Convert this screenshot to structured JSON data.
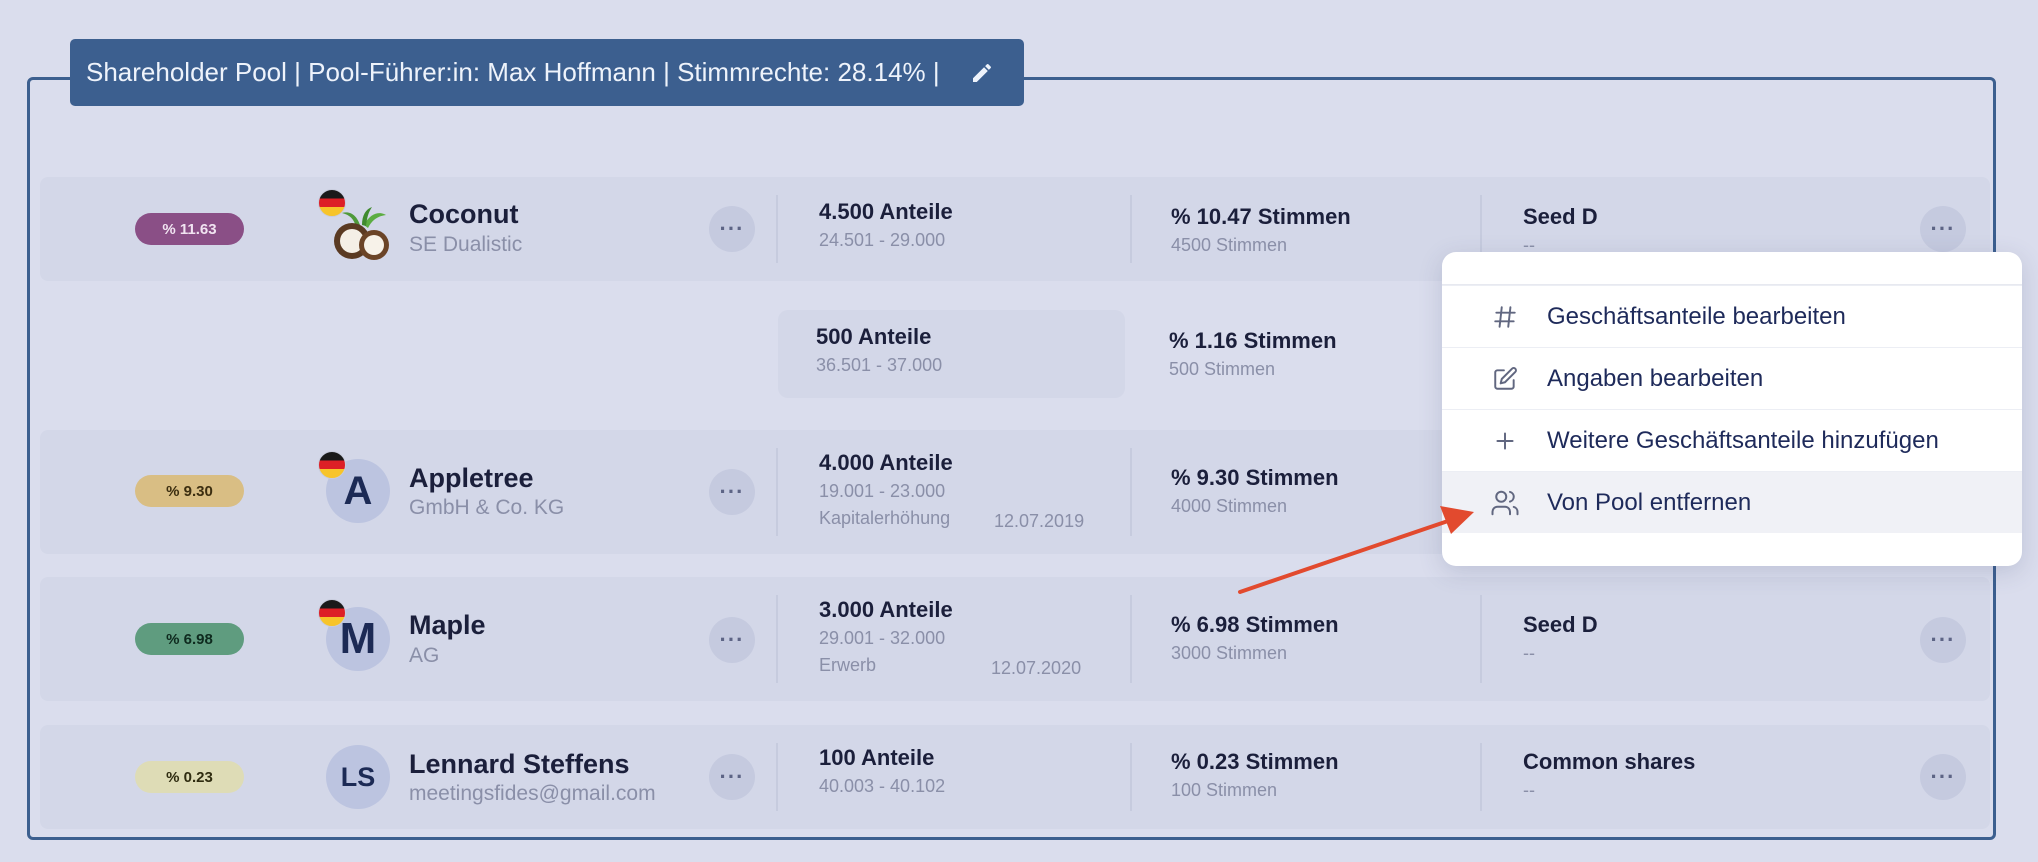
{
  "pool": {
    "title": "Shareholder Pool | Pool-Führer:in: Max Hoffmann | Stimmrechte: 28.14% |"
  },
  "rows": [
    {
      "percent": "% 11.63",
      "pill_color": "#8a4f86",
      "name": "Coconut",
      "subtitle": "SE Dualistic",
      "shares": "4.500 Anteile",
      "range": "24.501 - 29.000",
      "votes": "% 10.47 Stimmen",
      "votes_sub": "4500 Stimmen",
      "class": "Seed D",
      "class_sub": "--"
    },
    {
      "shares": "500 Anteile",
      "range": "36.501 - 37.000",
      "votes": "% 1.16 Stimmen",
      "votes_sub": "500 Stimmen"
    },
    {
      "percent": "% 9.30",
      "pill_color": "#d9be84",
      "avatar": "A",
      "name": "Appletree",
      "subtitle": "GmbH & Co. KG",
      "shares": "4.000 Anteile",
      "range": "19.001 - 23.000",
      "event": "Kapitalerhöhung",
      "date": "12.07.2019",
      "votes": "% 9.30 Stimmen",
      "votes_sub": "4000 Stimmen"
    },
    {
      "percent": "% 6.98",
      "pill_color": "#5f9c7f",
      "avatar": "M",
      "name": "Maple",
      "subtitle": "AG",
      "shares": "3.000 Anteile",
      "range": "29.001 - 32.000",
      "event": "Erwerb",
      "date": "12.07.2020",
      "votes": "% 6.98 Stimmen",
      "votes_sub": "3000 Stimmen",
      "class": "Seed D",
      "class_sub": "--"
    },
    {
      "percent": "% 0.23",
      "pill_color": "#dedcb6",
      "avatar": "LS",
      "name": "Lennard Steffens",
      "subtitle": "meetingsfides@gmail.com",
      "shares": "100 Anteile",
      "range": "40.003 - 40.102",
      "votes": "% 0.23 Stimmen",
      "votes_sub": "100 Stimmen",
      "class": "Common shares",
      "class_sub": "--"
    }
  ],
  "menu": {
    "items": [
      {
        "label": "Geschäftsanteile bearbeiten",
        "icon": "hash-icon"
      },
      {
        "label": "Angaben bearbeiten",
        "icon": "edit-icon"
      },
      {
        "label": "Weitere Geschäftsanteile hinzufügen",
        "icon": "plus-icon"
      },
      {
        "label": "Von Pool entfernen",
        "icon": "users-icon"
      }
    ]
  },
  "more_icon": "···",
  "colors": {
    "pool_border": "#3c5f8f",
    "arrow": "#e24a2e"
  }
}
